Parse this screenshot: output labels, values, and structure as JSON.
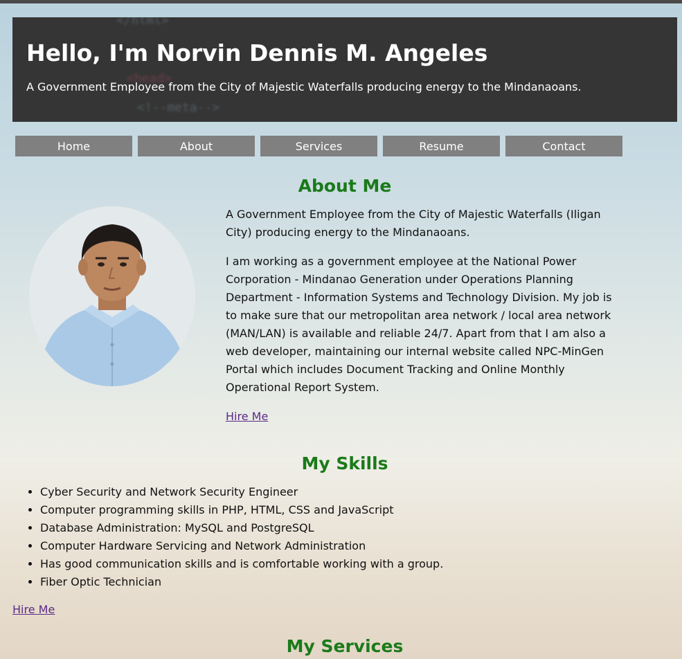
{
  "header": {
    "title": "Hello, I'm Norvin Dennis M. Angeles",
    "subtitle": "A Government Employee from the City of Majestic Waterfalls producing energy to the Mindanaoans."
  },
  "nav": [
    "Home",
    "About",
    "Services",
    "Resume",
    "Contact"
  ],
  "about": {
    "heading": "About Me",
    "p1": "A Government Employee from the City of Majestic Waterfalls (Iligan City) producing energy to the Mindanaoans.",
    "p2": "I am working as a government employee at the National Power Corporation - Mindanao Generation under Operations Planning Department - Information Systems and Technology Division. My job is to make sure that our metropolitan area network / local area network (MAN/LAN) is available and reliable 24/7. Apart from that I am also a web developer, maintaining our internal website called NPC-MinGen Portal which includes Document Tracking and Online Monthly Operational Report System.",
    "hire_link": "Hire Me"
  },
  "skills": {
    "heading": "My Skills",
    "items": [
      "Cyber Security and Network Security Engineer",
      "Computer programming skills in PHP, HTML, CSS and JavaScript",
      "Database Administration: MySQL and PostgreSQL",
      "Computer Hardware Servicing and Network Administration",
      "Has good communication skills and is comfortable working with a group.",
      "Fiber Optic Technician"
    ],
    "hire_link": "Hire Me"
  },
  "services": {
    "heading": "My Services"
  },
  "colors": {
    "heading_green": "#1a7a1a",
    "nav_gray": "#808080",
    "header_bg": "#353535",
    "link_purple": "#5a2a86"
  }
}
